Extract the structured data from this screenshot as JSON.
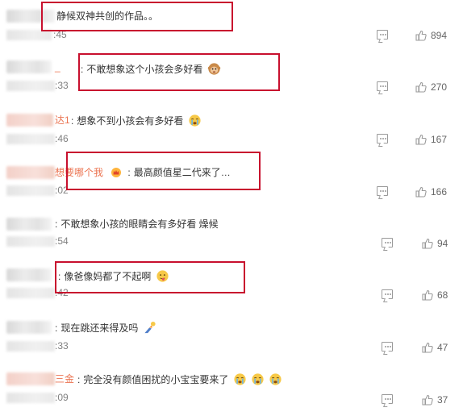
{
  "comments": [
    {
      "id": 1,
      "text": "静候双神共创的作品。。",
      "time_tail": "45",
      "likes": "894"
    },
    {
      "id": 2,
      "name_tail": "_",
      "text": "不敢想象这个小孩会多好看",
      "time_tail": "33",
      "likes": "270",
      "emoji": "monkey-face-emoji"
    },
    {
      "id": 3,
      "name_tail": "达1",
      "text": "想象不到小孩会有多好看",
      "time_tail": "46",
      "likes": "167",
      "emoji": "crying-face-emoji"
    },
    {
      "id": 4,
      "name_tail": "想要哪个我",
      "text": "最高颜值星二代来了…",
      "time_tail": "02",
      "likes": "166",
      "badge": "crown-badge-icon"
    },
    {
      "id": 5,
      "text": "不敢想象小孩的眼睛会有多好看 燥候",
      "time_tail": "54",
      "likes": "94"
    },
    {
      "id": 6,
      "text": "像爸像妈都了不起啊",
      "time_tail": "42",
      "likes": "68",
      "emoji": "tongue-face-emoji"
    },
    {
      "id": 7,
      "text": "现在跳还来得及吗",
      "time_tail": "33",
      "likes": "47",
      "emoji": "jumping-figure-emoji"
    },
    {
      "id": 8,
      "name_tail": "三金",
      "text": "完全没有颜值困扰的小宝宝要来了",
      "time_tail": "09",
      "likes": "37",
      "emoji": "crying-face-emoji"
    }
  ],
  "colors": {
    "highlight": "#c8102e",
    "username": "#eb7350",
    "icon": "#9a9a9a"
  }
}
